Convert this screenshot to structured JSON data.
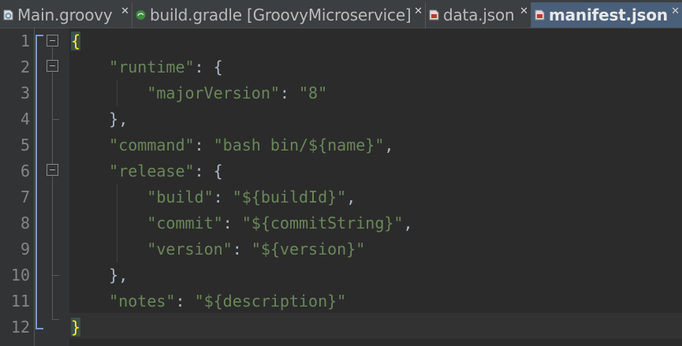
{
  "tabs": [
    {
      "label": "Main.groovy",
      "icon": "groovy-file-icon",
      "active": false
    },
    {
      "label": "build.gradle [GroovyMicroservice]",
      "icon": "gradle-file-icon",
      "active": false
    },
    {
      "label": "data.json",
      "icon": "json-file-icon",
      "active": false
    },
    {
      "label": "manifest.json",
      "icon": "json-file-icon",
      "active": true
    }
  ],
  "close_glyph": "✕",
  "lines": [
    {
      "num": "1",
      "tokens": [
        {
          "t": "{",
          "c": "brace hl"
        }
      ]
    },
    {
      "num": "2",
      "tokens": [
        {
          "t": "    "
        },
        {
          "t": "\"runtime\"",
          "c": "key"
        },
        {
          "t": ": {",
          "c": "punct"
        }
      ]
    },
    {
      "num": "3",
      "tokens": [
        {
          "t": "        "
        },
        {
          "t": "\"majorVersion\"",
          "c": "key"
        },
        {
          "t": ": ",
          "c": "punct"
        },
        {
          "t": "\"8\"",
          "c": "str"
        }
      ]
    },
    {
      "num": "4",
      "tokens": [
        {
          "t": "    "
        },
        {
          "t": "},",
          "c": "punct"
        }
      ]
    },
    {
      "num": "5",
      "tokens": [
        {
          "t": "    "
        },
        {
          "t": "\"command\"",
          "c": "key"
        },
        {
          "t": ": ",
          "c": "punct"
        },
        {
          "t": "\"bash bin/${name}\"",
          "c": "str"
        },
        {
          "t": ",",
          "c": "punct"
        }
      ]
    },
    {
      "num": "6",
      "tokens": [
        {
          "t": "    "
        },
        {
          "t": "\"release\"",
          "c": "key"
        },
        {
          "t": ": {",
          "c": "punct"
        }
      ]
    },
    {
      "num": "7",
      "tokens": [
        {
          "t": "        "
        },
        {
          "t": "\"build\"",
          "c": "key"
        },
        {
          "t": ": ",
          "c": "punct"
        },
        {
          "t": "\"${buildId}\"",
          "c": "str"
        },
        {
          "t": ",",
          "c": "punct"
        }
      ]
    },
    {
      "num": "8",
      "tokens": [
        {
          "t": "        "
        },
        {
          "t": "\"commit\"",
          "c": "key"
        },
        {
          "t": ": ",
          "c": "punct"
        },
        {
          "t": "\"${commitString}\"",
          "c": "str"
        },
        {
          "t": ",",
          "c": "punct"
        }
      ]
    },
    {
      "num": "9",
      "tokens": [
        {
          "t": "        "
        },
        {
          "t": "\"version\"",
          "c": "key"
        },
        {
          "t": ": ",
          "c": "punct"
        },
        {
          "t": "\"${version}\"",
          "c": "str"
        }
      ]
    },
    {
      "num": "10",
      "tokens": [
        {
          "t": "    "
        },
        {
          "t": "},",
          "c": "punct"
        }
      ]
    },
    {
      "num": "11",
      "tokens": [
        {
          "t": "    "
        },
        {
          "t": "\"notes\"",
          "c": "key"
        },
        {
          "t": ": ",
          "c": "punct"
        },
        {
          "t": "\"${description}\"",
          "c": "str"
        }
      ]
    },
    {
      "num": "12",
      "tokens": [
        {
          "t": "}",
          "c": "brace hl"
        }
      ]
    }
  ],
  "colors": {
    "background": "#2b2b2b",
    "gutter": "#313335",
    "string": "#6a8759",
    "punctuation": "#a9b7c6",
    "brace_match": "#ffef28",
    "line_number": "#858585",
    "active_tab": "#4a5f7a"
  }
}
